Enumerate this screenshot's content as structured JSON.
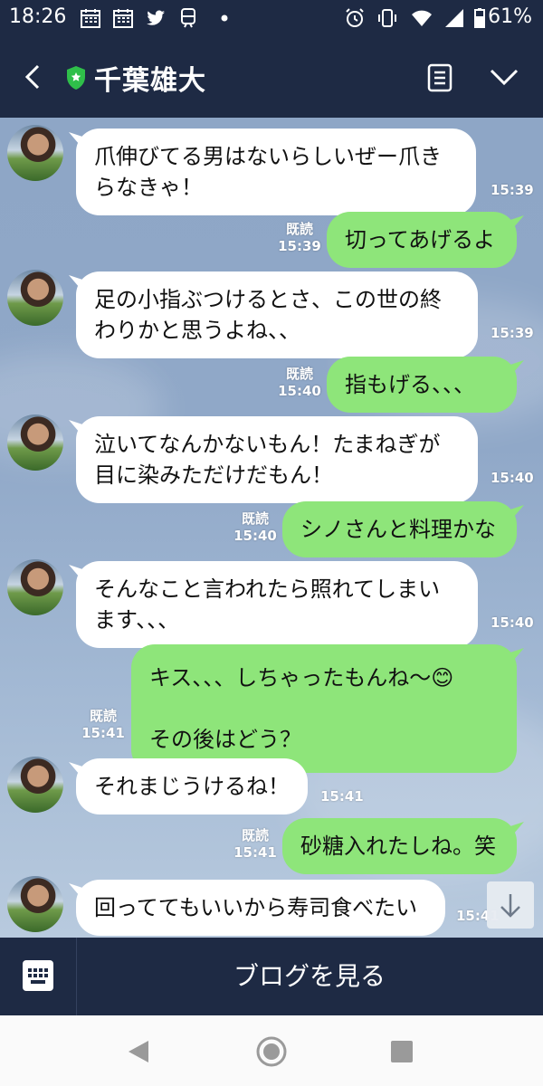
{
  "status_bar": {
    "time": "18:26",
    "battery": "61%"
  },
  "header": {
    "title": "千葉雄大"
  },
  "messages": [
    {
      "text": "爪伸びてる男はないらしいぜー爪き\nらなきゃ！",
      "time": "15:39"
    },
    {
      "text": "切ってあげるよ",
      "time": "15:39",
      "read": "既読"
    },
    {
      "text": "足の小指ぶつけるとさ、この世の終\nわりかと思うよね、、",
      "time": "15:39"
    },
    {
      "text": "指もげる、、、",
      "time": "15:40",
      "read": "既読"
    },
    {
      "text": "泣いてなんかないもん！たまねぎが\n目に染みただけだもん！",
      "time": "15:40"
    },
    {
      "text": "シノさんと料理かな",
      "time": "15:40",
      "read": "既読"
    },
    {
      "text": "そんなこと言われたら照れてしまい\nます、、、",
      "time": "15:40"
    },
    {
      "text": "キス、、、しちゃったもんね〜😊\n\nその後はどう？",
      "time": "15:41",
      "read": "既読"
    },
    {
      "text": "それまじうけるね！",
      "time": "15:41"
    },
    {
      "text": "砂糖入れたしね。笑",
      "time": "15:41",
      "read": "既読"
    },
    {
      "text": "回っててもいいから寿司食べたい",
      "time": "15:41"
    }
  ],
  "bottom_bar": {
    "blog_label": "ブログを見る"
  },
  "colors": {
    "header_bg": "#1e2a44",
    "outgoing_bubble": "#8ee57a",
    "incoming_bubble": "#ffffff",
    "accent_shield": "#2fbf4a"
  }
}
